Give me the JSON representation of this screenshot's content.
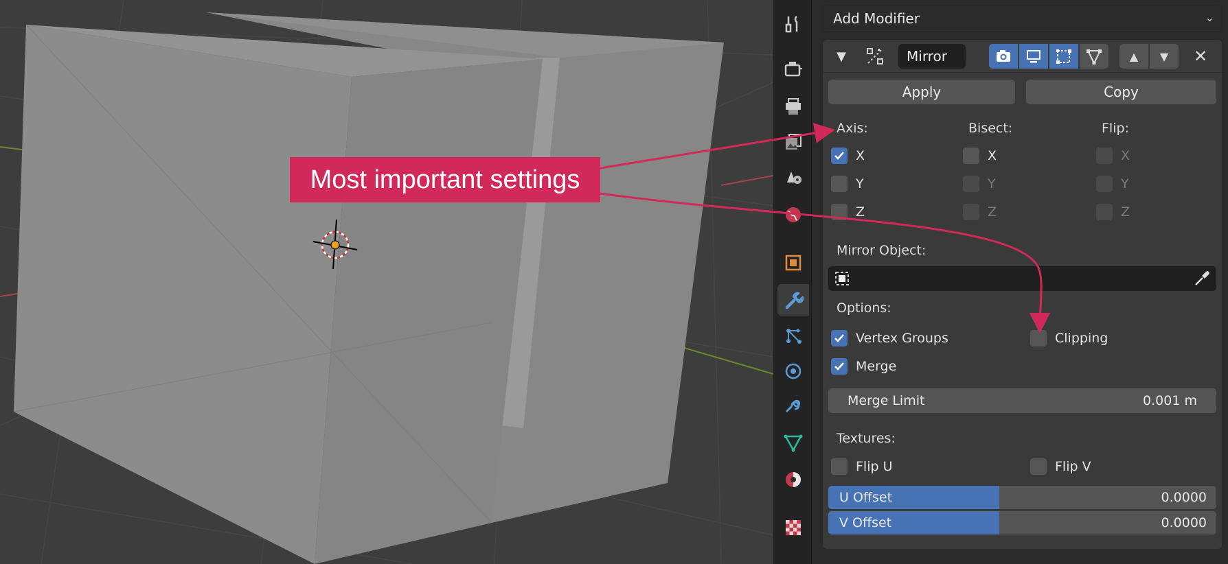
{
  "viewport": {
    "background": "#3d3d3d"
  },
  "annotation": {
    "text": "Most important settings",
    "color": "#d0295a"
  },
  "panel": {
    "add_modifier": "Add Modifier",
    "modifier": {
      "name": "Mirror",
      "apply_label": "Apply",
      "copy_label": "Copy",
      "axis_label": "Axis:",
      "bisect_label": "Bisect:",
      "flip_label": "Flip:",
      "axis": [
        {
          "label": "X",
          "checked": true
        },
        {
          "label": "Y",
          "checked": false
        },
        {
          "label": "Z",
          "checked": false
        }
      ],
      "bisect": [
        {
          "label": "X"
        },
        {
          "label": "Y"
        },
        {
          "label": "Z"
        }
      ],
      "flip": [
        {
          "label": "X"
        },
        {
          "label": "Y"
        },
        {
          "label": "Z"
        }
      ],
      "mirror_object_label": "Mirror Object:",
      "options_label": "Options:",
      "vertex_groups_label": "Vertex Groups",
      "vertex_groups_checked": true,
      "clipping_label": "Clipping",
      "clipping_checked": false,
      "merge_label": "Merge",
      "merge_checked": true,
      "merge_limit_label": "Merge Limit",
      "merge_limit_value": "0.001 m",
      "textures_label": "Textures:",
      "flip_u_label": "Flip U",
      "flip_v_label": "Flip V",
      "u_offset_label": "U Offset",
      "u_offset_value": "0.0000",
      "v_offset_label": "V Offset",
      "v_offset_value": "0.0000",
      "offset_fill_fraction": 0.44
    }
  },
  "accent_color": "#4772b3",
  "tabs": [
    {
      "name": "tool-tab",
      "icon": "tool-icon"
    },
    {
      "name": "render-tab",
      "icon": "render-icon"
    },
    {
      "name": "output-tab",
      "icon": "output-icon"
    },
    {
      "name": "view-layer-tab",
      "icon": "view-layer-icon"
    },
    {
      "name": "scene-tab",
      "icon": "scene-icon"
    },
    {
      "name": "world-tab",
      "icon": "world-icon"
    },
    {
      "name": "object-tab",
      "icon": "object-icon"
    },
    {
      "name": "modifier-tab",
      "icon": "wrench-icon",
      "active": true
    },
    {
      "name": "particles-tab",
      "icon": "particles-icon"
    },
    {
      "name": "physics-tab",
      "icon": "physics-icon"
    },
    {
      "name": "constraints-tab",
      "icon": "constraint-icon"
    },
    {
      "name": "data-tab",
      "icon": "mesh-data-icon"
    },
    {
      "name": "material-tab",
      "icon": "material-icon"
    },
    {
      "name": "texture-tab",
      "icon": "texture-icon"
    }
  ]
}
